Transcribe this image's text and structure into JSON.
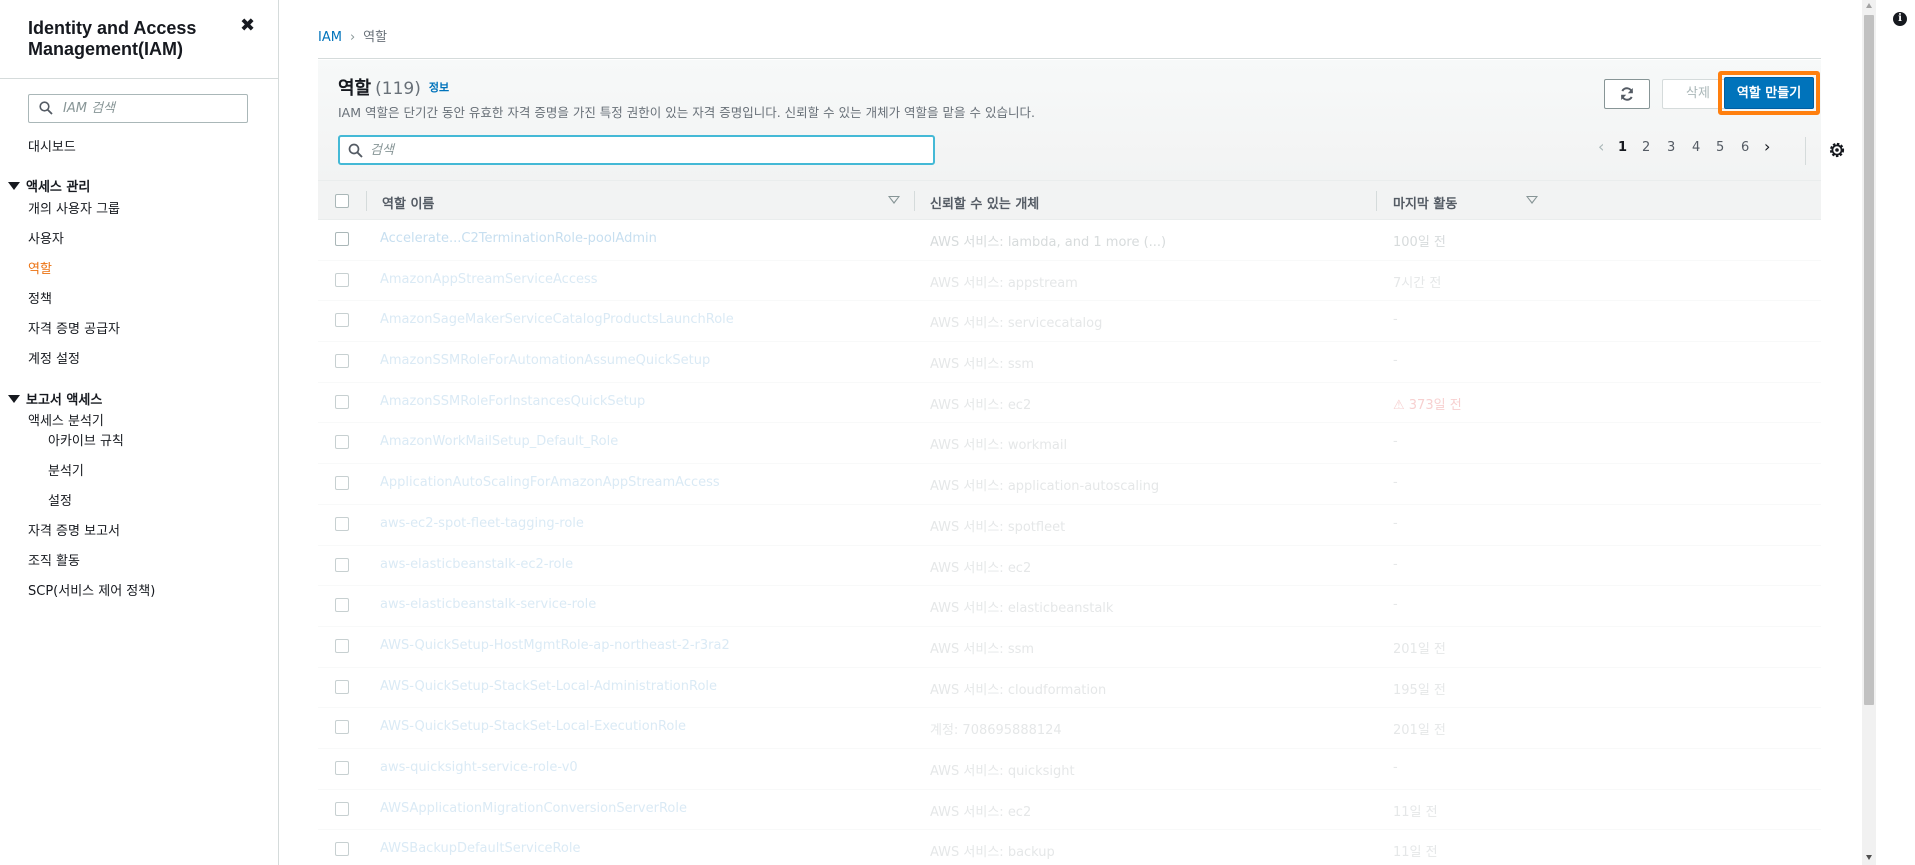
{
  "sidebar": {
    "title": "Identity and Access Management(IAM)",
    "search_placeholder": "IAM 검색",
    "dashboard": "대시보드",
    "access_mgmt_section": "액세스 관리",
    "access_mgmt_items": [
      "개의 사용자 그룹",
      "사용자",
      "역할",
      "정책",
      "자격 증명 공급자",
      "계정 설정"
    ],
    "active_item": "역할",
    "reports_section": "보고서 액세스",
    "reports_items": [
      "액세스 분석기",
      "아카이브 규칙",
      "분석기",
      "설정",
      "자격 증명 보고서",
      "조직 활동",
      "SCP(서비스 제어 정책)"
    ]
  },
  "breadcrumb": {
    "root": "IAM",
    "current": "역할"
  },
  "header": {
    "title": "역할",
    "count": "(119)",
    "info": "정보",
    "description": "IAM 역할은 단기간 동안 유효한 자격 증명을 가진 특정 권한이 있는 자격 증명입니다. 신뢰할 수 있는 개체가 역할을 맡을 수 있습니다.",
    "delete_label": "삭제",
    "create_label": "역할 만들기",
    "search_placeholder": "검색",
    "pages": [
      "1",
      "2",
      "3",
      "4",
      "5",
      "6"
    ],
    "current_page": "1"
  },
  "table": {
    "columns": [
      "역할 이름",
      "신뢰할 수 있는 개체",
      "마지막 활동"
    ],
    "rows": [
      {
        "name": "Accelerate...C2TerminationRole-poolAdmin",
        "trusted": "AWS 서비스: lambda, and 1 more (...)",
        "last": "100일 전",
        "warn": false
      },
      {
        "name": "AmazonAppStreamServiceAccess",
        "trusted": "AWS 서비스: appstream",
        "last": "7시간 전",
        "warn": false
      },
      {
        "name": "AmazonSageMakerServiceCatalogProductsLaunchRole",
        "trusted": "AWS 서비스: servicecatalog",
        "last": "-",
        "warn": false
      },
      {
        "name": "AmazonSSMRoleForAutomationAssumeQuickSetup",
        "trusted": "AWS 서비스: ssm",
        "last": "-",
        "warn": false
      },
      {
        "name": "AmazonSSMRoleForInstancesQuickSetup",
        "trusted": "AWS 서비스: ec2",
        "last": "⚠ 373일 전",
        "warn": true
      },
      {
        "name": "AmazonWorkMailSetup_Default_Role",
        "trusted": "AWS 서비스: workmail",
        "last": "-",
        "warn": false
      },
      {
        "name": "ApplicationAutoScalingForAmazonAppStreamAccess",
        "trusted": "AWS 서비스: application-autoscaling",
        "last": "-",
        "warn": false
      },
      {
        "name": "aws-ec2-spot-fleet-tagging-role",
        "trusted": "AWS 서비스: spotfleet",
        "last": "-",
        "warn": false
      },
      {
        "name": "aws-elasticbeanstalk-ec2-role",
        "trusted": "AWS 서비스: ec2",
        "last": "-",
        "warn": false
      },
      {
        "name": "aws-elasticbeanstalk-service-role",
        "trusted": "AWS 서비스: elasticbeanstalk",
        "last": "-",
        "warn": false
      },
      {
        "name": "AWS-QuickSetup-HostMgmtRole-ap-northeast-2-r3ra2",
        "trusted": "AWS 서비스: ssm",
        "last": "201일 전",
        "warn": false
      },
      {
        "name": "AWS-QuickSetup-StackSet-Local-AdministrationRole",
        "trusted": "AWS 서비스: cloudformation",
        "last": "195일 전",
        "warn": false
      },
      {
        "name": "AWS-QuickSetup-StackSet-Local-ExecutionRole",
        "trusted": "계정: 708695888124",
        "last": "201일 전",
        "warn": false
      },
      {
        "name": "aws-quicksight-service-role-v0",
        "trusted": "AWS 서비스: quicksight",
        "last": "-",
        "warn": false
      },
      {
        "name": "AWSApplicationMigrationConversionServerRole",
        "trusted": "AWS 서비스: ec2",
        "last": "11일 전",
        "warn": false
      },
      {
        "name": "AWSBackupDefaultServiceRole",
        "trusted": "AWS 서비스: backup",
        "last": "11일 전",
        "warn": false
      }
    ]
  },
  "colors": {
    "accent": "#ec7211",
    "primary_button": "#0073bb",
    "highlight_outline": "#ff7f0e",
    "link": "#0073bb"
  },
  "icons": [
    "close-icon",
    "search-icon",
    "refresh-icon",
    "settings-gear-icon",
    "info-icon"
  ]
}
